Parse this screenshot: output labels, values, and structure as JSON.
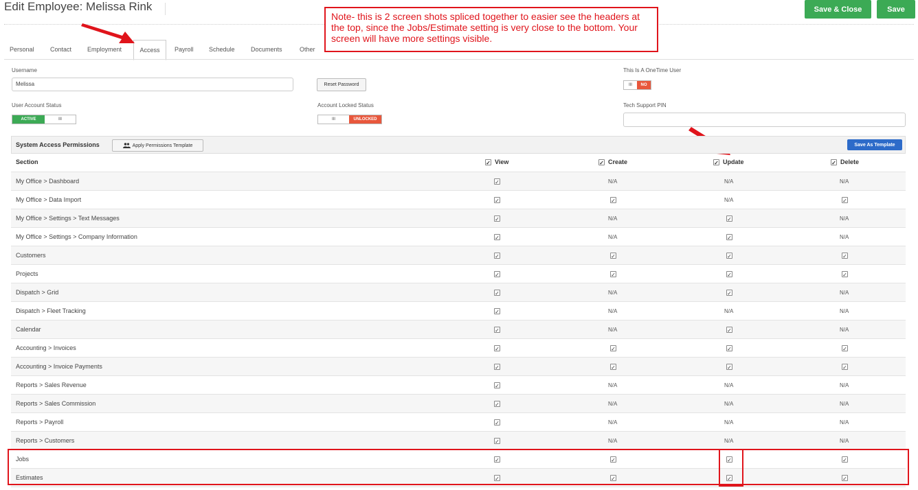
{
  "header": {
    "title": "Edit Employee: Melissa Rink",
    "save_close_label": "Save & Close",
    "save_label": "Save"
  },
  "note": "Note- this is 2 screen shots spliced together to easier see the headers at the top, since the Jobs/Estimate setting is very close to the bottom. Your screen will have more settings visible.",
  "tabs": [
    "Personal",
    "Contact",
    "Employment",
    "Access",
    "Payroll",
    "Schedule",
    "Documents",
    "Other"
  ],
  "active_tab": "Access",
  "form": {
    "username_label": "Username",
    "username_value": "Melissa",
    "reset_password_label": "Reset Password",
    "onetime_label": "This Is A OneTime User",
    "onetime_off": "III",
    "onetime_no": "NO",
    "account_status_label": "User Account Status",
    "account_active": "ACTIVE",
    "account_toggle": "III",
    "locked_status_label": "Account Locked Status",
    "locked_toggle": "III",
    "locked_value": "UNLOCKED",
    "tech_pin_label": "Tech Support PIN",
    "tech_pin_value": ""
  },
  "permissions": {
    "title": "System Access Permissions",
    "apply_template_label": "Apply Permissions Template",
    "save_template_label": "Save As Template",
    "columns": {
      "section": "Section",
      "view": "View",
      "create": "Create",
      "update": "Update",
      "delete": "Delete"
    },
    "check_glyph": "✓",
    "rows": [
      {
        "section": "My Office > Dashboard",
        "view": "✓",
        "create": "N/A",
        "update": "N/A",
        "delete": "N/A"
      },
      {
        "section": "My Office > Data Import",
        "view": "✓",
        "create": "✓",
        "update": "N/A",
        "delete": "✓"
      },
      {
        "section": "My Office > Settings > Text Messages",
        "view": "✓",
        "create": "N/A",
        "update": "✓",
        "delete": "N/A"
      },
      {
        "section": "My Office > Settings > Company Information",
        "view": "✓",
        "create": "N/A",
        "update": "✓",
        "delete": "N/A"
      },
      {
        "section": "Customers",
        "view": "✓",
        "create": "✓",
        "update": "✓",
        "delete": "✓"
      },
      {
        "section": "Projects",
        "view": "✓",
        "create": "✓",
        "update": "✓",
        "delete": "✓"
      },
      {
        "section": "Dispatch > Grid",
        "view": "✓",
        "create": "N/A",
        "update": "✓",
        "delete": "N/A"
      },
      {
        "section": "Dispatch > Fleet Tracking",
        "view": "✓",
        "create": "N/A",
        "update": "N/A",
        "delete": "N/A"
      },
      {
        "section": "Calendar",
        "view": "✓",
        "create": "N/A",
        "update": "✓",
        "delete": "N/A"
      },
      {
        "section": "Accounting > Invoices",
        "view": "✓",
        "create": "✓",
        "update": "✓",
        "delete": "✓"
      },
      {
        "section": "Accounting > Invoice Payments",
        "view": "✓",
        "create": "✓",
        "update": "✓",
        "delete": "✓"
      },
      {
        "section": "Reports > Sales Revenue",
        "view": "✓",
        "create": "N/A",
        "update": "N/A",
        "delete": "N/A"
      },
      {
        "section": "Reports > Sales Commission",
        "view": "✓",
        "create": "N/A",
        "update": "N/A",
        "delete": "N/A"
      },
      {
        "section": "Reports > Payroll",
        "view": "✓",
        "create": "N/A",
        "update": "N/A",
        "delete": "N/A"
      },
      {
        "section": "Reports > Customers",
        "view": "✓",
        "create": "N/A",
        "update": "N/A",
        "delete": "N/A"
      },
      {
        "section": "Jobs",
        "view": "✓",
        "create": "✓",
        "update": "✓",
        "delete": "✓"
      },
      {
        "section": "Estimates",
        "view": "✓",
        "create": "✓",
        "update": "✓",
        "delete": "✓"
      }
    ]
  },
  "colors": {
    "accent_green": "#3caa55",
    "accent_red": "#e0141b",
    "accent_blue": "#2d6bc9",
    "toggle_orange": "#e8573c"
  }
}
